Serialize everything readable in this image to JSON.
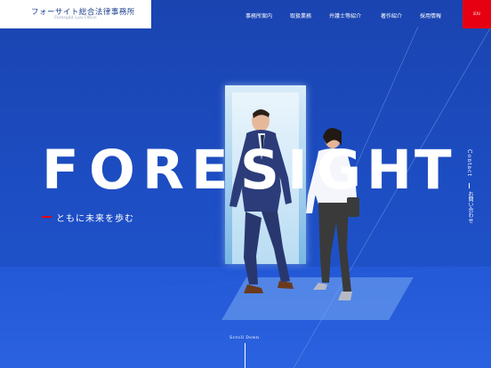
{
  "header": {
    "logo_title": "フォーサイト総合法律事務所",
    "logo_sub": "Foresight Law Office",
    "nav": [
      {
        "label": "事務所案内"
      },
      {
        "label": "取扱業務"
      },
      {
        "label": "弁護士等紹介"
      },
      {
        "label": "著作紹介"
      },
      {
        "label": "採用情報"
      }
    ],
    "nav_right_label": "EN"
  },
  "hero": {
    "letters": [
      "F",
      "O",
      "R",
      "E",
      "S",
      "I",
      "G",
      "H",
      "T"
    ],
    "tagline": "ともに未来を歩む"
  },
  "side": {
    "contact": "Contact",
    "contact_jp": "お問い合わせ"
  },
  "scroll": {
    "label": "Scroll Down"
  },
  "colors": {
    "brand_blue": "#1b47b4",
    "accent_red": "#e60012",
    "logo_text": "#1d3f8c"
  }
}
